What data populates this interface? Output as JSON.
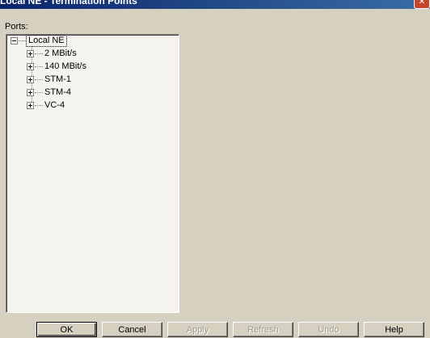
{
  "window": {
    "title": "Local NE - Termination Points",
    "close_glyph": "✕"
  },
  "ports": {
    "label": "Ports:",
    "root": {
      "label": "Local NE",
      "expanded": true
    },
    "children": [
      {
        "label": "2 MBit/s",
        "expanded": false
      },
      {
        "label": "140 MBit/s",
        "expanded": false
      },
      {
        "label": "STM-1",
        "expanded": false
      },
      {
        "label": "STM-4",
        "expanded": false
      },
      {
        "label": "VC-4",
        "expanded": false
      }
    ]
  },
  "buttons": {
    "ok": "OK",
    "cancel": "Cancel",
    "apply": "Apply",
    "refresh": "Refresh",
    "undo": "Undo",
    "help": "Help"
  }
}
